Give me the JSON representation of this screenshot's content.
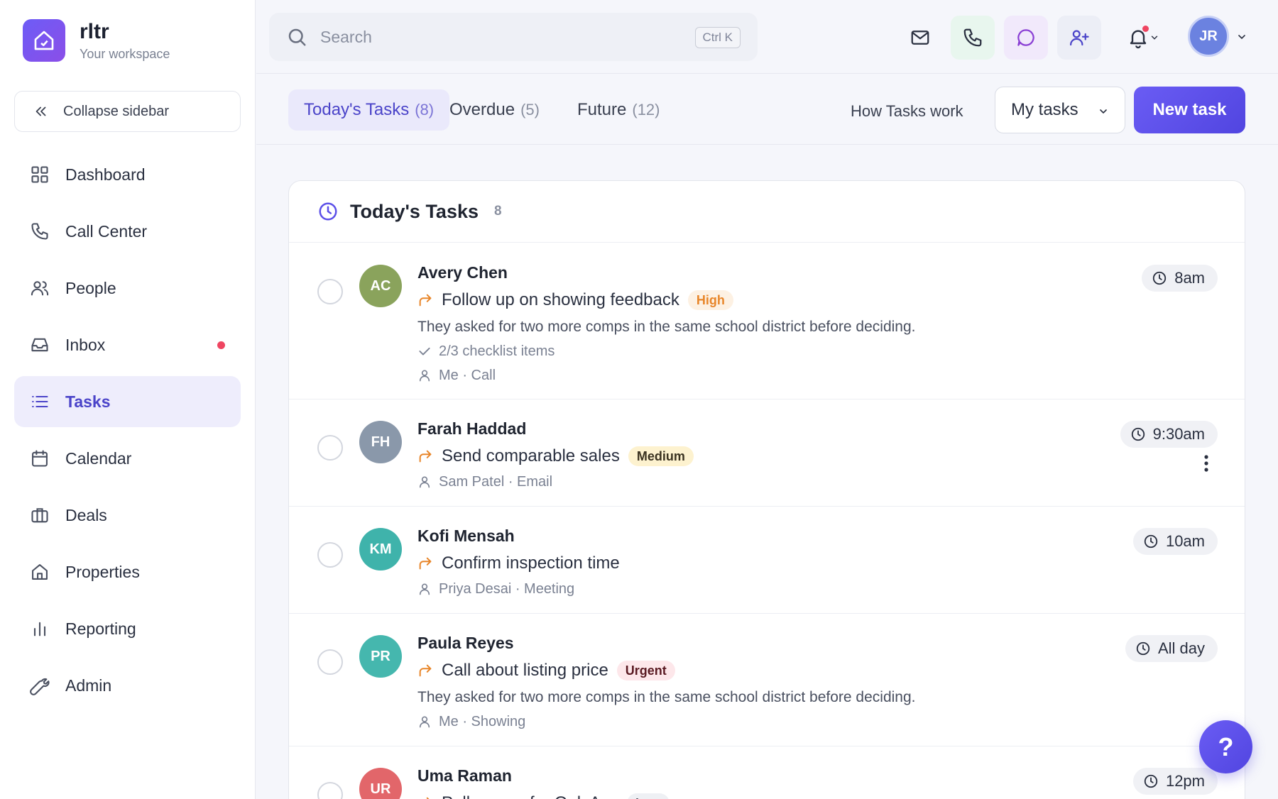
{
  "brand": {
    "name": "rltr",
    "subtitle": "Your workspace"
  },
  "sidebar": {
    "collapse_label": "Collapse sidebar",
    "items": [
      {
        "label": "Dashboard",
        "icon": "grid-icon"
      },
      {
        "label": "Call Center",
        "icon": "phone-icon"
      },
      {
        "label": "People",
        "icon": "users-icon"
      },
      {
        "label": "Inbox",
        "icon": "inbox-icon",
        "has_dot": true
      },
      {
        "label": "Tasks",
        "icon": "list-icon",
        "active": true
      },
      {
        "label": "Calendar",
        "icon": "calendar-icon"
      },
      {
        "label": "Deals",
        "icon": "briefcase-icon"
      },
      {
        "label": "Properties",
        "icon": "home-icon"
      },
      {
        "label": "Reporting",
        "icon": "bar-chart-icon"
      },
      {
        "label": "Admin",
        "icon": "wrench-icon"
      }
    ]
  },
  "topbar": {
    "search_placeholder": "Search",
    "search_shortcut": "Ctrl K",
    "user_initials": "JR"
  },
  "tabs": [
    {
      "label": "Today's Tasks",
      "count": "(8)",
      "active": true
    },
    {
      "label": "Overdue",
      "count": "(5)"
    },
    {
      "label": "Future",
      "count": "(12)"
    }
  ],
  "actions": {
    "help_link": "How Tasks work",
    "filter_value": "My tasks",
    "new_task_label": "New task"
  },
  "card": {
    "title": "Today's Tasks",
    "count": "8"
  },
  "tasks": [
    {
      "initials": "AC",
      "name": "Avery Chen",
      "title": "Follow up on showing feedback",
      "priority": "High",
      "description": "They asked for two more comps in the same school district before deciding.",
      "checklist": "2/3 checklist items",
      "meta": "Me · Call",
      "time": "8am"
    },
    {
      "initials": "FH",
      "name": "Farah Haddad",
      "title": "Send comparable sales",
      "priority": "Medium",
      "meta": "Sam Patel · Email",
      "time": "9:30am"
    },
    {
      "initials": "KM",
      "name": "Kofi Mensah",
      "title": "Confirm inspection time",
      "meta": "Priya Desai · Meeting",
      "time": "10am"
    },
    {
      "initials": "PR",
      "name": "Paula Reyes",
      "title": "Call about listing price",
      "priority": "Urgent",
      "description": "They asked for two more comps in the same school district before deciding.",
      "meta": "Me · Showing",
      "time": "All day"
    },
    {
      "initials": "UR",
      "name": "Uma Raman",
      "title": "Pull comps for Oak Ave",
      "priority": "Low",
      "time": "12pm"
    }
  ],
  "colors": {
    "accent": "#5b4fe8",
    "avatar_ac": "#8aa35c",
    "avatar_fh": "#8a98aa",
    "avatar_km": "#3fb3ab",
    "avatar_pr": "#45b7ae",
    "avatar_ur": "#e2666a",
    "high_bg": "#fdf1e3",
    "high_fg": "#e8862a",
    "medium_bg": "#fdf2cf",
    "medium_fg": "#3a3220",
    "urgent_bg": "#fde7ea",
    "urgent_fg": "#5a1a22",
    "low_bg": "#eef0f4",
    "low_fg": "#4a5060"
  },
  "help_button_label": "?"
}
